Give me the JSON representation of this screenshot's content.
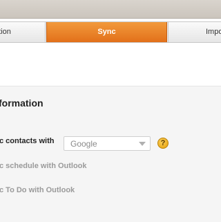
{
  "tabs": [
    {
      "label": "ation",
      "active": false
    },
    {
      "label": "Sync",
      "active": true
    },
    {
      "label": "Impo",
      "active": false
    }
  ],
  "section": {
    "title": "formation"
  },
  "rows": [
    {
      "label": "c contacts with",
      "enabled": true
    },
    {
      "label": "c schedule with Outlook",
      "enabled": false
    },
    {
      "label": "c To Do with Outlook",
      "enabled": false
    }
  ],
  "contacts_select": {
    "value": "Google"
  },
  "help": {
    "glyph": "?"
  },
  "colors": {
    "accent": "#e8801f",
    "disabled_text": "#9a9a9a",
    "help_icon": "#f0b21c"
  }
}
